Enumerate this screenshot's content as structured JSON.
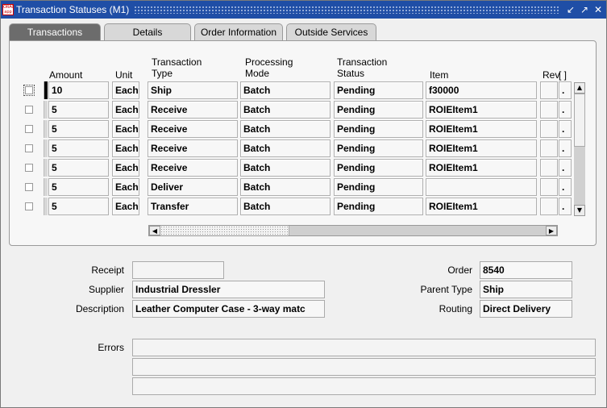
{
  "window": {
    "title": "Transaction Statuses (M1)",
    "icon_text": "ORACLE"
  },
  "tabs": [
    {
      "label": "Transactions",
      "active": true
    },
    {
      "label": "Details",
      "active": false
    },
    {
      "label": "Order Information",
      "active": false
    },
    {
      "label": "Outside Services",
      "active": false
    }
  ],
  "table": {
    "headers": {
      "amount": "Amount",
      "unit": "Unit",
      "transaction_type": "Transaction\nType",
      "processing_mode": "Processing\nMode",
      "transaction_status": "Transaction\nStatus",
      "item": "Item",
      "rev": "Rev",
      "extra": "[ ]"
    },
    "rows": [
      {
        "amount": "10",
        "unit": "Each",
        "type": "Ship",
        "mode": "Batch",
        "status": "Pending",
        "item": "f30000",
        "rev": "",
        "extra": "."
      },
      {
        "amount": "5",
        "unit": "Each",
        "type": "Receive",
        "mode": "Batch",
        "status": "Pending",
        "item": "ROIEItem1",
        "rev": "",
        "extra": "."
      },
      {
        "amount": "5",
        "unit": "Each",
        "type": "Receive",
        "mode": "Batch",
        "status": "Pending",
        "item": "ROIEItem1",
        "rev": "",
        "extra": "."
      },
      {
        "amount": "5",
        "unit": "Each",
        "type": "Receive",
        "mode": "Batch",
        "status": "Pending",
        "item": "ROIEItem1",
        "rev": "",
        "extra": "."
      },
      {
        "amount": "5",
        "unit": "Each",
        "type": "Receive",
        "mode": "Batch",
        "status": "Pending",
        "item": "ROIEItem1",
        "rev": "",
        "extra": "."
      },
      {
        "amount": "5",
        "unit": "Each",
        "type": "Deliver",
        "mode": "Batch",
        "status": "Pending",
        "item": "",
        "rev": "",
        "extra": "."
      },
      {
        "amount": "5",
        "unit": "Each",
        "type": "Transfer",
        "mode": "Batch",
        "status": "Pending",
        "item": "ROIEItem1",
        "rev": "",
        "extra": "."
      }
    ]
  },
  "details": {
    "receipt_label": "Receipt",
    "receipt_value": "",
    "supplier_label": "Supplier",
    "supplier_value": "Industrial Dressler",
    "description_label": "Description",
    "description_value": "Leather Computer Case - 3-way matc",
    "order_label": "Order",
    "order_value": "8540",
    "parent_type_label": "Parent Type",
    "parent_type_value": "Ship",
    "routing_label": "Routing",
    "routing_value": "Direct Delivery",
    "errors_label": "Errors",
    "errors": [
      "",
      "",
      ""
    ]
  },
  "colors": {
    "titlebar": "#1f4ea6",
    "active_tab": "#6c6c6c",
    "field_bg": "#f7f7f7"
  }
}
